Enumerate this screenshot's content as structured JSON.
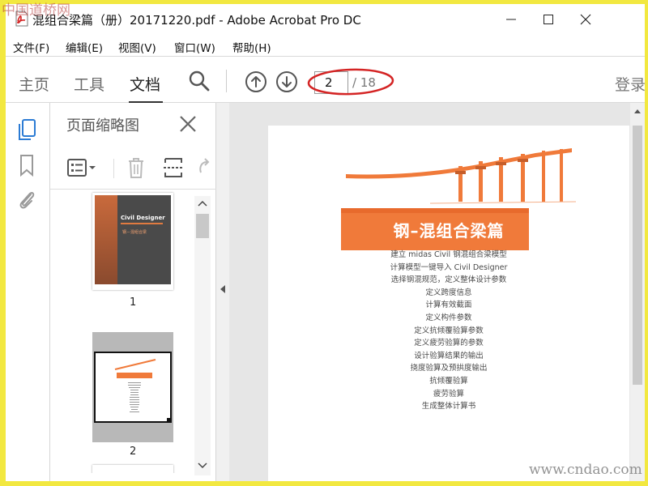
{
  "window": {
    "title": "混组合梁篇（册）20171220.pdf - Adobe Acrobat Pro DC"
  },
  "menu": {
    "items": [
      {
        "label": "文件(F)"
      },
      {
        "label": "编辑(E)"
      },
      {
        "label": "视图(V)"
      },
      {
        "label": "窗口(W)"
      },
      {
        "label": "帮助(H)"
      }
    ]
  },
  "toolbar": {
    "tabs": [
      {
        "label": "主页"
      },
      {
        "label": "工具"
      },
      {
        "label": "文档"
      }
    ],
    "active_tab": "文档",
    "current_page": "2",
    "page_total": "/ 18",
    "login_label": "登录",
    "highlight_color": "#d42424"
  },
  "sidebar": {
    "panel_title": "页面缩略图",
    "thumbnails": [
      {
        "label": "1"
      },
      {
        "label": "2"
      }
    ],
    "cover_brand": "Civil Designer",
    "cover_title": "钢－混组合梁"
  },
  "document": {
    "title": "钢–混组合梁篇",
    "lines": [
      "建立 midas Civil 钢混组合梁模型",
      "计算模型一键导入 Civil Designer",
      "选择钢混规范，定义整体设计参数",
      "定义跨度信息",
      "计算有效截面",
      "定义构件参数",
      "定义抗倾覆验算参数",
      "定义疲劳验算的参数",
      "设计验算结果的输出",
      "挠度验算及预拱度输出",
      "抗倾覆验算",
      "疲劳验算",
      "生成整体计算书"
    ],
    "accent_color": "#f07a3a"
  },
  "watermarks": {
    "top": "中国道桥网",
    "bottom": "www.cndao.com"
  }
}
